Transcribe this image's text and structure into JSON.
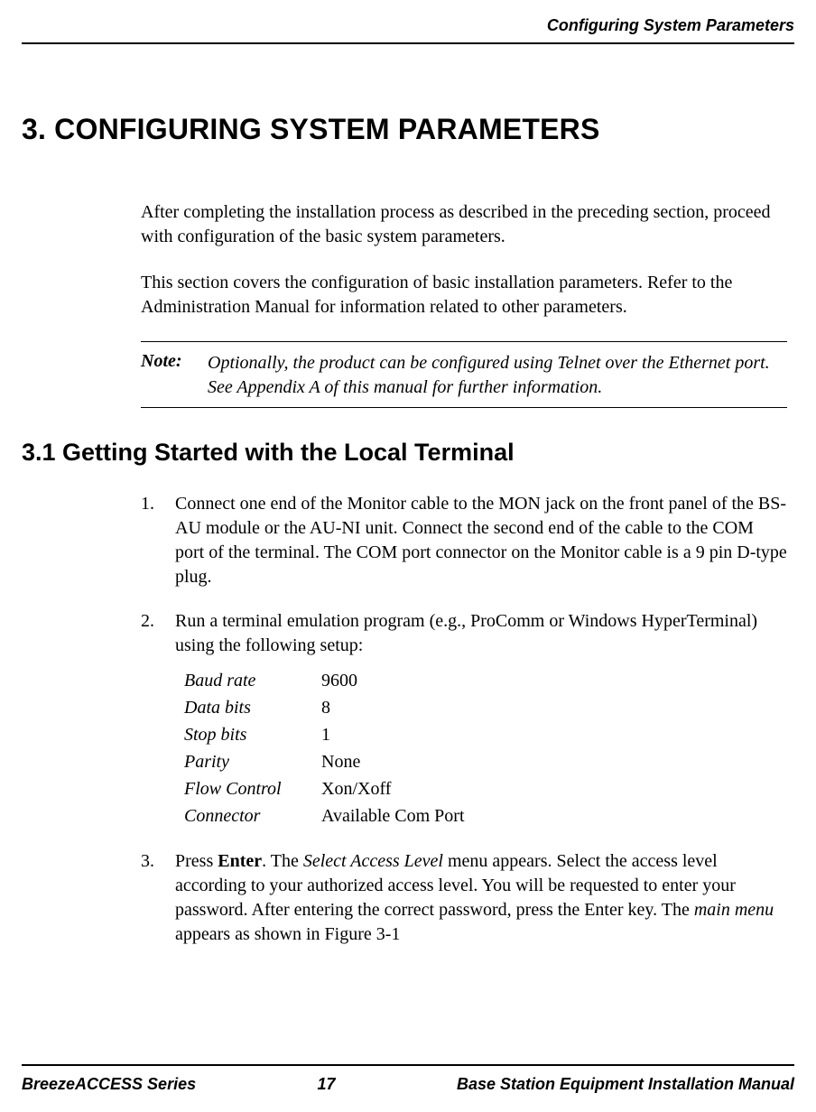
{
  "header": {
    "running_title": "Configuring System Parameters"
  },
  "section": {
    "h1": "3. CONFIGURING SYSTEM PARAMETERS",
    "intro_p1": "After completing the installation process as described in the preceding section, proceed with configuration of the basic system parameters.",
    "intro_p2": "This section covers the configuration of basic installation parameters. Refer to the Administration Manual for information related to other parameters.",
    "note_label": "Note:",
    "note_text": "Optionally, the product can be configured using Telnet over the Ethernet port. See Appendix A of this manual for further information.",
    "h2": "3.1  Getting Started with the Local Terminal",
    "steps": {
      "s1_num": "1.",
      "s1_text": "Connect one end of the Monitor cable to the MON jack on the front panel of the BS-AU module or the AU-NI unit. Connect the second end of the cable to the COM port of the terminal. The COM port connector on the Monitor cable is a 9 pin D-type plug.",
      "s2_num": "2.",
      "s2_text": "Run a terminal emulation program (e.g., ProComm or Windows HyperTerminal) using the following setup:",
      "settings": [
        {
          "key": "Baud rate",
          "val": "9600"
        },
        {
          "key": "Data bits",
          "val": "8"
        },
        {
          "key": "Stop bits",
          "val": "1"
        },
        {
          "key": "Parity",
          "val": "None"
        },
        {
          "key": "Flow Control",
          "val": "Xon/Xoff"
        },
        {
          "key": "Connector",
          "val": "Available Com Port"
        }
      ],
      "s3_num": "3.",
      "s3_part1": "Press ",
      "s3_enter": "Enter",
      "s3_part2": ". The ",
      "s3_sal": "Select Access Level",
      "s3_part3": " menu appears. Select the access level according to your authorized access level. You will be requested to enter your password. After entering the correct password, press the Enter key. The ",
      "s3_mm": "main menu",
      "s3_part4": " appears as shown in Figure 3-1"
    }
  },
  "footer": {
    "left": "BreezeACCESS Series",
    "page": "17",
    "right": "Base Station Equipment Installation Manual"
  }
}
